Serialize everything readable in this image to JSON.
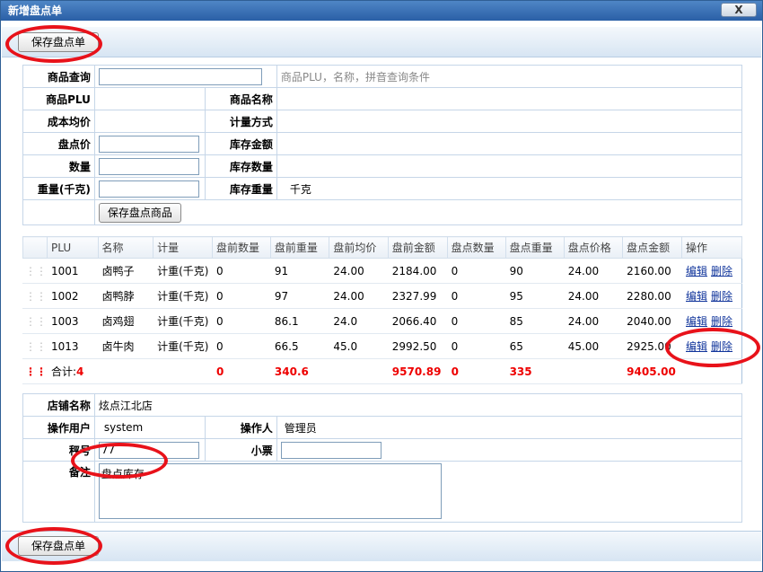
{
  "window": {
    "title": "新增盘点单",
    "close_label": "X"
  },
  "toolbar": {
    "save_label": "保存盘点单"
  },
  "search": {
    "query_label": "商品查询",
    "query_value": "",
    "query_hint": "商品PLU，名称，拼音查询条件",
    "plu_label": "商品PLU",
    "name_label": "商品名称",
    "cost_label": "成本均价",
    "measure_label": "计量方式",
    "price_label": "盘点价",
    "stock_amount_label": "库存金额",
    "qty_label": "数量",
    "stock_qty_label": "库存数量",
    "weight_label": "重量(千克)",
    "stock_weight_label": "库存重量",
    "stock_weight_value": "千克",
    "save_item_label": "保存盘点商品"
  },
  "grid": {
    "columns": [
      "PLU",
      "名称",
      "计量",
      "盘前数量",
      "盘前重量",
      "盘前均价",
      "盘前金额",
      "盘点数量",
      "盘点重量",
      "盘点价格",
      "盘点金额",
      "操作"
    ],
    "edit_label": "编辑",
    "delete_label": "删除",
    "rows": [
      [
        "1001",
        "卤鸭子",
        "计重(千克)",
        "0",
        "91",
        "24.00",
        "2184.00",
        "0",
        "90",
        "24.00",
        "2160.00"
      ],
      [
        "1002",
        "卤鸭脖",
        "计重(千克)",
        "0",
        "97",
        "24.00",
        "2327.99",
        "0",
        "95",
        "24.00",
        "2280.00"
      ],
      [
        "1003",
        "卤鸡翅",
        "计重(千克)",
        "0",
        "86.1",
        "24.0",
        "2066.40",
        "0",
        "85",
        "24.00",
        "2040.00"
      ],
      [
        "1013",
        "卤牛肉",
        "计重(千克)",
        "0",
        "66.5",
        "45.0",
        "2992.50",
        "0",
        "65",
        "45.00",
        "2925.00"
      ]
    ],
    "total": {
      "label": "合计:",
      "count": "4",
      "pre_qty": "0",
      "pre_weight": "340.6",
      "pre_amount": "9570.89",
      "qty": "0",
      "weight": "335",
      "amount": "9405.00"
    }
  },
  "footer_form": {
    "store_label": "店铺名称",
    "store_value": "炫点江北店",
    "user_label": "操作用户",
    "user_value": "system",
    "operator_label": "操作人",
    "operator_value": "管理员",
    "scale_label": "秤号",
    "scale_value": "77",
    "ticket_label": "小票",
    "ticket_value": "",
    "remark_label": "备注",
    "remark_value": "盘点库存"
  }
}
